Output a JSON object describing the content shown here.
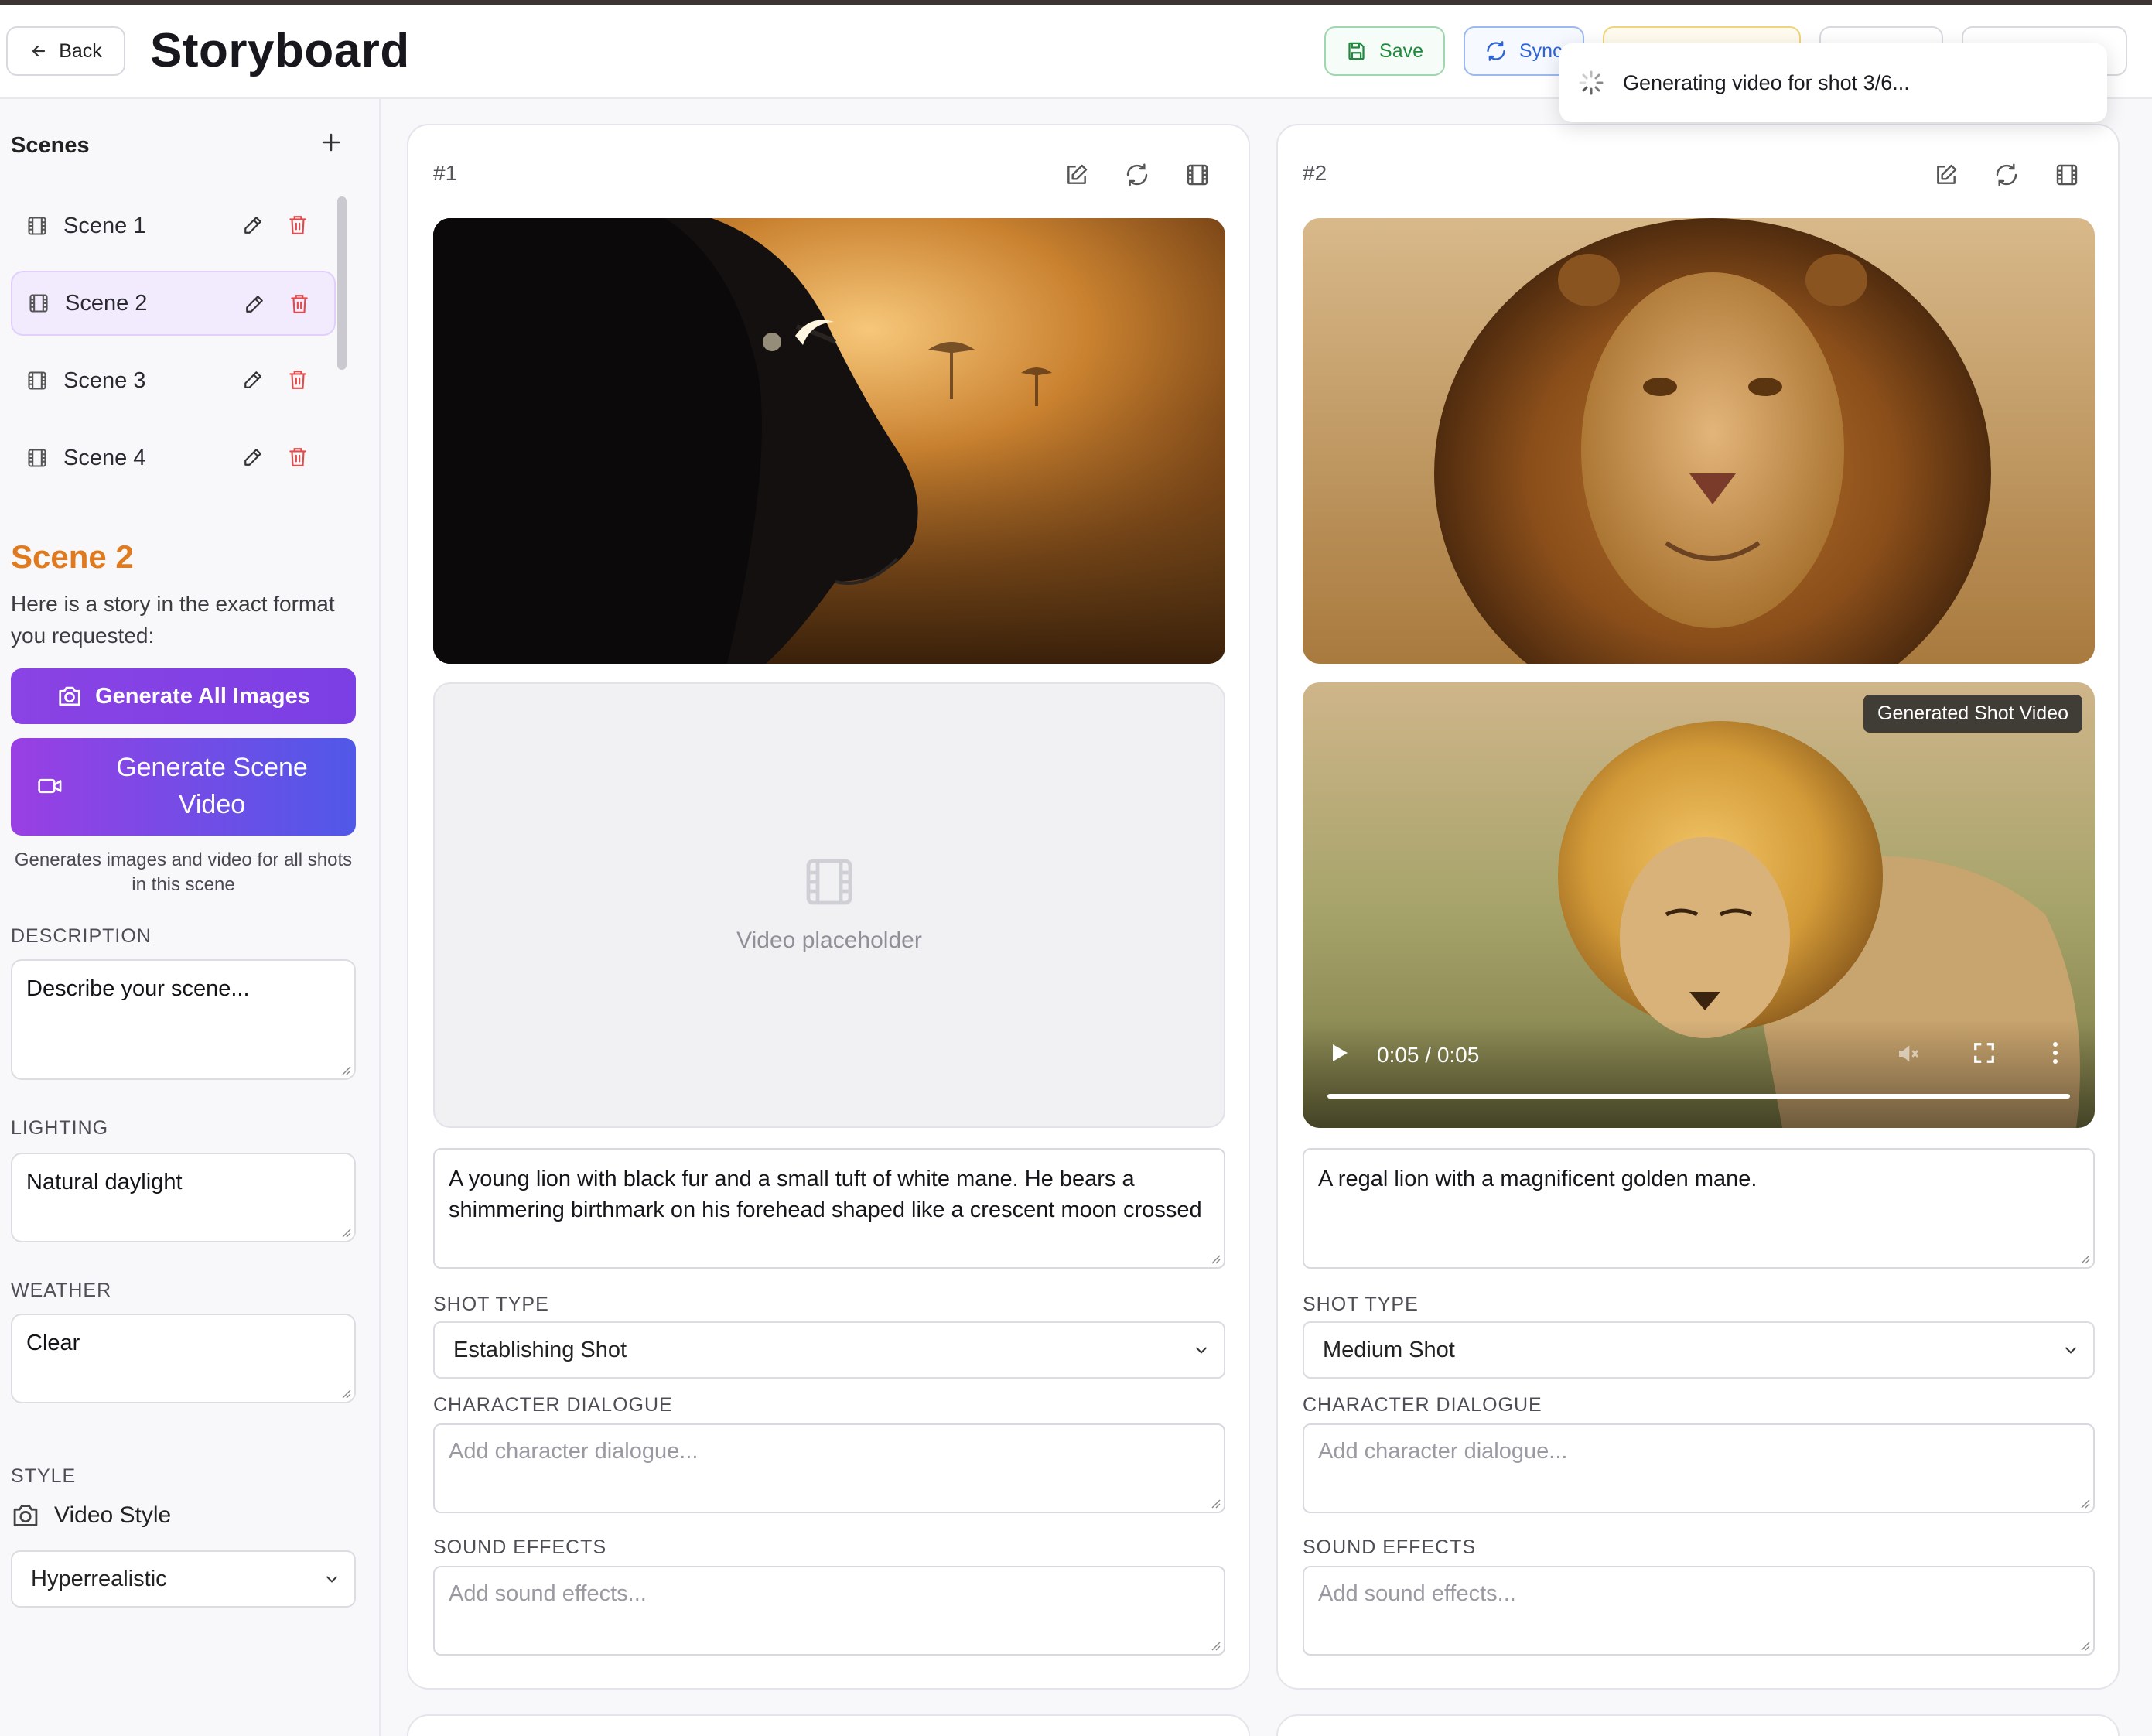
{
  "header": {
    "back_label": "Back",
    "title": "Storyboard",
    "save_label": "Save",
    "sync_label": "Sync"
  },
  "toast": {
    "message": "Generating video for shot 3/6..."
  },
  "sidebar": {
    "scenes_title": "Scenes",
    "add_icon": "plus-icon",
    "items": [
      {
        "label": "Scene 1",
        "active": false
      },
      {
        "label": "Scene 2",
        "active": true
      },
      {
        "label": "Scene 3",
        "active": false
      },
      {
        "label": "Scene 4",
        "active": false
      }
    ],
    "selected_scene": {
      "heading": "Scene 2",
      "subtitle": "Here is a story in the exact format you requested:"
    },
    "generate_all_label": "Generate All Images",
    "generate_video_label": "Generate Scene Video",
    "generate_note": "Generates images and video for all shots in this scene",
    "description_label": "DESCRIPTION",
    "description_placeholder": "Describe your scene...",
    "lighting_label": "LIGHTING",
    "lighting_value": "Natural daylight",
    "weather_label": "WEATHER",
    "weather_value": "Clear",
    "style_label": "STYLE",
    "video_style_label": "Video Style",
    "style_value": "Hyperrealistic"
  },
  "shots": [
    {
      "number": "#1",
      "video_placeholder": "Video placeholder",
      "description": "A young lion with black fur and a small tuft of white mane. He bears a shimmering birthmark on his forehead shaped like a crescent moon crossed",
      "shot_type_label": "SHOT TYPE",
      "shot_type": "Establishing Shot",
      "dialogue_label": "CHARACTER DIALOGUE",
      "dialogue_placeholder": "Add character dialogue...",
      "sfx_label": "SOUND EFFECTS",
      "sfx_placeholder": "Add sound effects..."
    },
    {
      "number": "#2",
      "video_badge": "Generated Shot Video",
      "video_time": "0:05 / 0:05",
      "video_progress": 1.0,
      "description": "A regal lion with a magnificent golden mane.",
      "shot_type_label": "SHOT TYPE",
      "shot_type": "Medium Shot",
      "dialogue_label": "CHARACTER DIALOGUE",
      "dialogue_placeholder": "Add character dialogue...",
      "sfx_label": "SOUND EFFECTS",
      "sfx_placeholder": "Add sound effects..."
    }
  ],
  "colors": {
    "accent_purple": "#8a43e4",
    "scene_heading_orange": "#e07a1e",
    "save_green": "#1f8a3e",
    "sync_blue": "#2d63d8"
  }
}
